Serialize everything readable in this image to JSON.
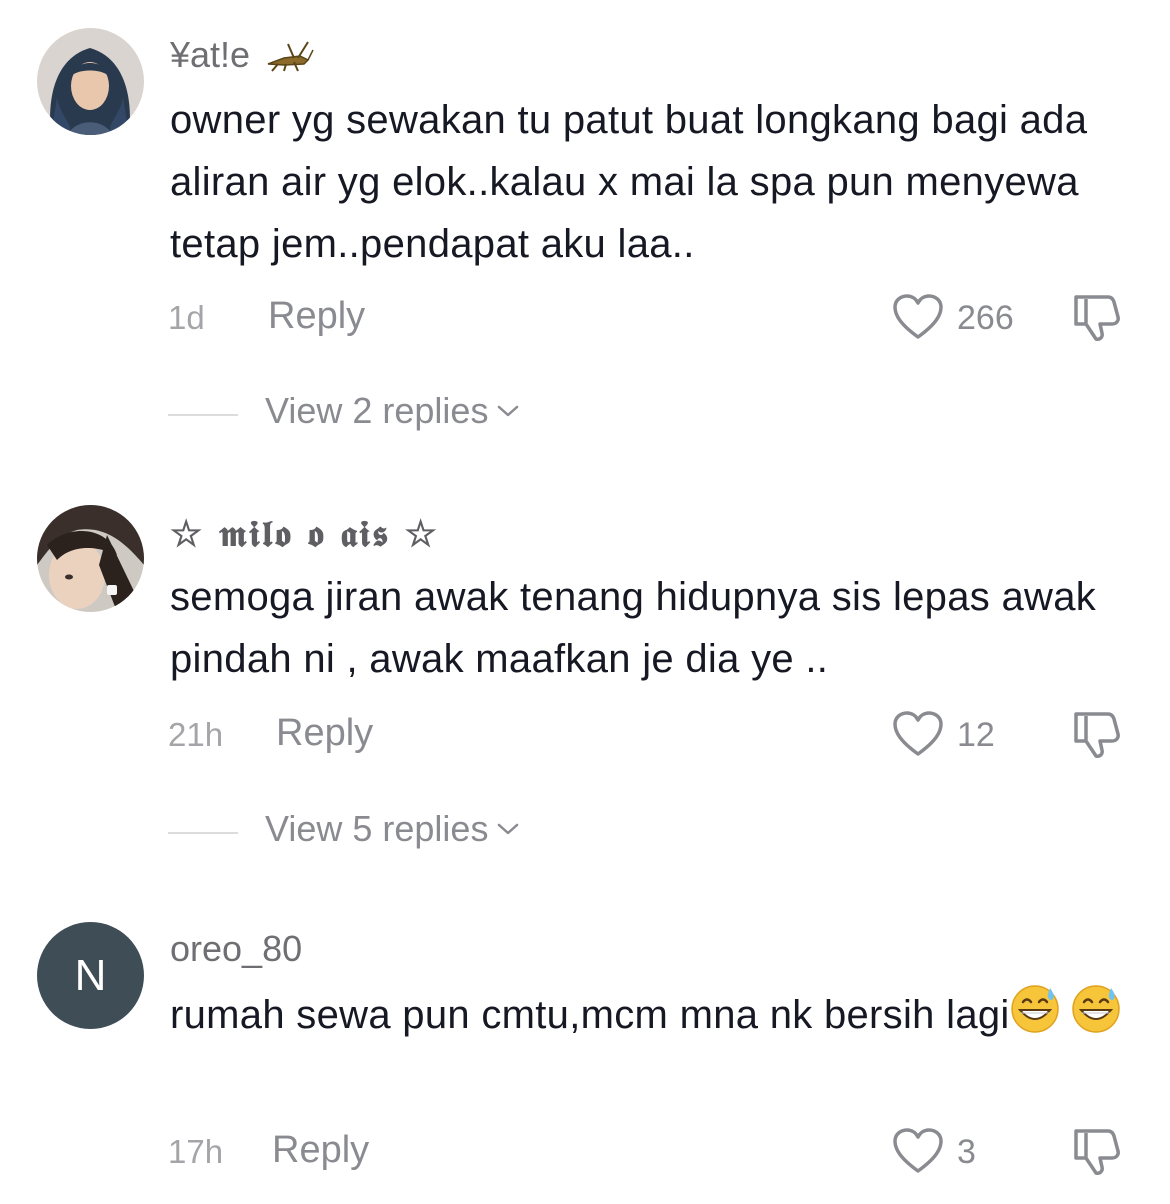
{
  "comments": [
    {
      "username": "¥at!e",
      "username_icon": "cricket-icon",
      "avatar": "hijab-woman-photo",
      "text": "owner yg sewakan tu patut buat longkang bagi ada aliran air yg elok..kalau x mai la spa pun menyewa tetap jem..pendapat aku laa..",
      "time": "1d",
      "reply_label": "Reply",
      "likes": "266",
      "view_replies": "View 2 replies"
    },
    {
      "username": "☆ 𝖒𝖎𝖑𝖔 𝖔 𝖆𝖎𝖘 ☆",
      "avatar": "girl-hair-photo",
      "text": "semoga jiran awak tenang hidupnya sis lepas awak pindah ni , awak maafkan je dia ye ..",
      "time": "21h",
      "reply_label": "Reply",
      "likes": "12",
      "view_replies": "View 5 replies"
    },
    {
      "username": "oreo_80",
      "avatar_letter": "N",
      "text": "rumah sewa pun cmtu,mcm mna nk bersih lagi",
      "emojis": [
        "grinning-face-with-sweat-emoji",
        "grinning-face-with-sweat-emoji"
      ],
      "time": "17h",
      "reply_label": "Reply",
      "likes": "3"
    }
  ],
  "colors": {
    "text_primary": "#161823",
    "text_secondary": "#8a8b91",
    "avatar_letter_bg": "#3f4d56"
  }
}
